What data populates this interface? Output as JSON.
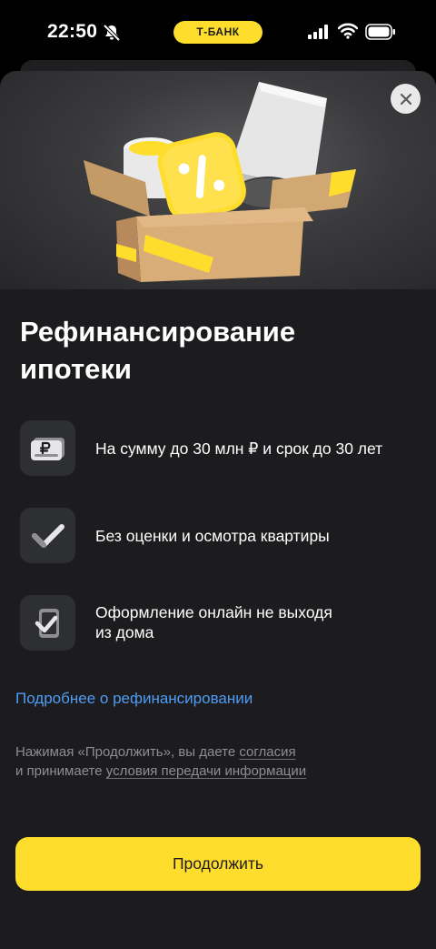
{
  "status_bar": {
    "time": "22:50",
    "bank_badge": "Т‑БАНК",
    "badge_color": "#ffdd2d"
  },
  "hero": {
    "illustration": "cardboard-box-with-lamp-mug-and-tbank-logo"
  },
  "title": {
    "line1": "Рефинансирование",
    "line2": "ипотеки"
  },
  "features": [
    {
      "icon": "ruble-bill-icon",
      "text": "На сумму до 30 млн ₽ и срок до 30 лет"
    },
    {
      "icon": "checkmark-icon",
      "text": "Без оценки и осмотра квартиры"
    },
    {
      "icon": "phone-check-icon",
      "line1": "Оформление онлайн не выходя",
      "line2": "из дома"
    }
  ],
  "more_link": "Подробнее о рефинансировании",
  "consent": {
    "part1": "Нажимая «Продолжить», вы даете ",
    "link1": "согласия",
    "part2": "и принимаете ",
    "link2": "условия передачи информации"
  },
  "continue_button": "Продолжить",
  "colors": {
    "accent": "#ffdd2d",
    "link": "#4e9cf5",
    "sheet_bg": "#1c1c1e",
    "icon_tile": "#2e2f33"
  }
}
